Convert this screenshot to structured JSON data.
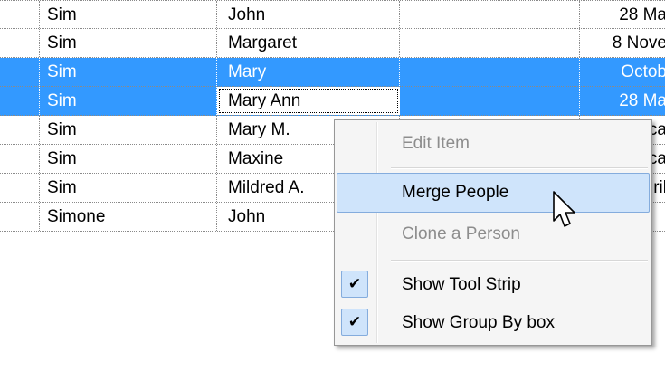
{
  "rows": [
    {
      "last": "Sim",
      "first": "John",
      "date": "28 Ma",
      "selected": false
    },
    {
      "last": "Sim",
      "first": "Margaret",
      "date": "8 Nove",
      "selected": false
    },
    {
      "last": "Sim",
      "first": "Mary",
      "date": "Octob",
      "selected": true
    },
    {
      "last": "Sim",
      "first": "Mary Ann",
      "date": "28 Ma",
      "selected": true
    },
    {
      "last": "Sim",
      "first": "Mary M.",
      "date": "ca",
      "selected": false
    },
    {
      "last": "Sim",
      "first": "Maxine",
      "date": "ca",
      "selected": false
    },
    {
      "last": "Sim",
      "first": "Mildred A.",
      "date": "ril",
      "selected": false
    },
    {
      "last": "Simone",
      "first": "John",
      "date": "",
      "selected": false
    }
  ],
  "context_menu": {
    "items": [
      {
        "label": "Edit Item",
        "state": "disabled"
      },
      {
        "label": "Merge People",
        "state": "hover"
      },
      {
        "label": "Clone a Person",
        "state": "disabled"
      },
      {
        "label": "Show Tool Strip",
        "state": "checked",
        "check_glyph": "✔"
      },
      {
        "label": "Show Group By box",
        "state": "checked",
        "check_glyph": "✔"
      }
    ]
  },
  "colors": {
    "selection": "#3399ff",
    "menu_hover": "#cfe4fb",
    "menu_background": "#f5f5f5",
    "disabled_text": "#8d8d8d"
  }
}
